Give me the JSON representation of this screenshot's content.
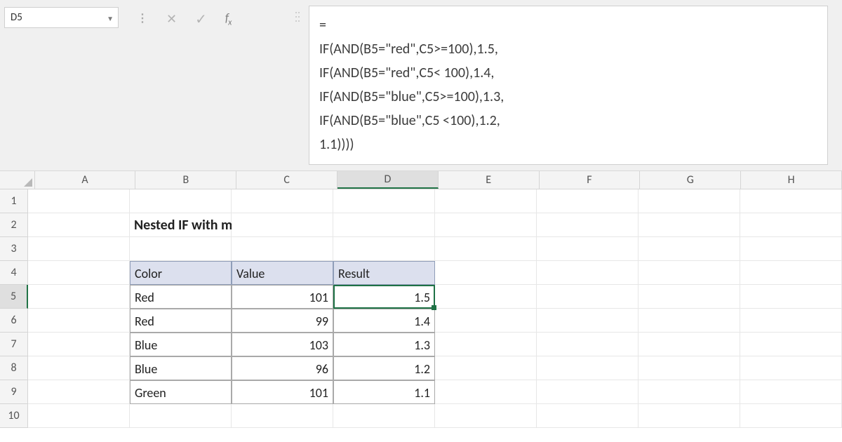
{
  "name_box": {
    "value": "D5"
  },
  "formula_bar": {
    "text": "=\nIF(AND(B5=\"red\",C5>=100),1.5,\nIF(AND(B5=\"red\",C5< 100),1.4,\nIF(AND(B5=\"blue\",C5>=100),1.3,\nIF(AND(B5=\"blue\",C5 <100),1.2,\n1.1))))"
  },
  "columns": [
    "A",
    "B",
    "C",
    "D",
    "E",
    "F",
    "G",
    "H"
  ],
  "active_column": "D",
  "row_numbers": [
    "1",
    "2",
    "3",
    "4",
    "5",
    "6",
    "7",
    "8",
    "9",
    "10"
  ],
  "active_row": "5",
  "title": "Nested IF with multiple AND",
  "table": {
    "headers": {
      "color": "Color",
      "value": "Value",
      "result": "Result"
    },
    "rows": [
      {
        "color": "Red",
        "value": "101",
        "result": "1.5"
      },
      {
        "color": "Red",
        "value": "99",
        "result": "1.4"
      },
      {
        "color": "Blue",
        "value": "103",
        "result": "1.3"
      },
      {
        "color": "Blue",
        "value": "96",
        "result": "1.2"
      },
      {
        "color": "Green",
        "value": "101",
        "result": "1.1"
      }
    ]
  },
  "selected_cell": {
    "col_index": 3,
    "row_index": 4
  }
}
